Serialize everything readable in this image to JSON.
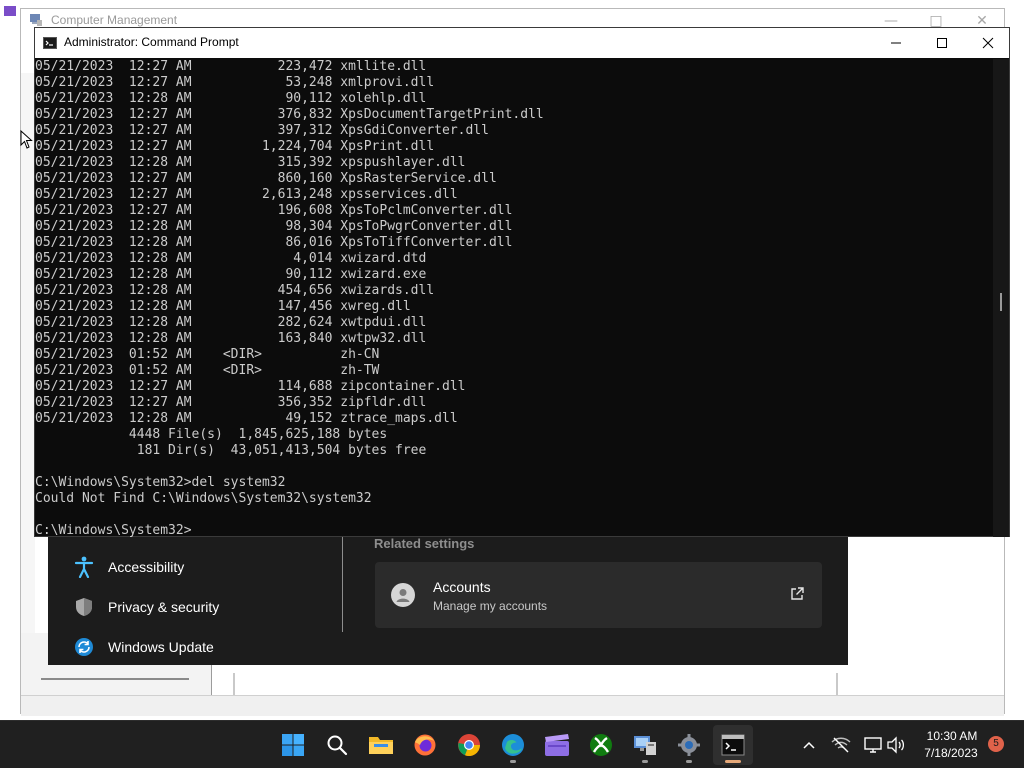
{
  "background_window": {
    "title": "Computer Management"
  },
  "settings": {
    "nav_items": [
      {
        "label": "Accessibility",
        "icon": "accessibility-icon"
      },
      {
        "label": "Privacy & security",
        "icon": "shield-icon"
      },
      {
        "label": "Windows Update",
        "icon": "windows-update-icon"
      }
    ],
    "related_settings_title": "Related settings",
    "accounts_card": {
      "title": "Accounts",
      "subtitle": "Manage my accounts",
      "icon": "external-link-icon"
    }
  },
  "cmd": {
    "title": "Administrator: Command Prompt",
    "lines": [
      "05/21/2023  12:27 AM           223,472 xmllite.dll",
      "05/21/2023  12:27 AM            53,248 xmlprovi.dll",
      "05/21/2023  12:28 AM            90,112 xolehlp.dll",
      "05/21/2023  12:27 AM           376,832 XpsDocumentTargetPrint.dll",
      "05/21/2023  12:27 AM           397,312 XpsGdiConverter.dll",
      "05/21/2023  12:27 AM         1,224,704 XpsPrint.dll",
      "05/21/2023  12:28 AM           315,392 xpspushlayer.dll",
      "05/21/2023  12:27 AM           860,160 XpsRasterService.dll",
      "05/21/2023  12:27 AM         2,613,248 xpsservices.dll",
      "05/21/2023  12:27 AM           196,608 XpsToPclmConverter.dll",
      "05/21/2023  12:28 AM            98,304 XpsToPwgrConverter.dll",
      "05/21/2023  12:28 AM            86,016 XpsToTiffConverter.dll",
      "05/21/2023  12:28 AM             4,014 xwizard.dtd",
      "05/21/2023  12:28 AM            90,112 xwizard.exe",
      "05/21/2023  12:28 AM           454,656 xwizards.dll",
      "05/21/2023  12:28 AM           147,456 xwreg.dll",
      "05/21/2023  12:28 AM           282,624 xwtpdui.dll",
      "05/21/2023  12:28 AM           163,840 xwtpw32.dll",
      "05/21/2023  01:52 AM    <DIR>          zh-CN",
      "05/21/2023  01:52 AM    <DIR>          zh-TW",
      "05/21/2023  12:27 AM           114,688 zipcontainer.dll",
      "05/21/2023  12:27 AM           356,352 zipfldr.dll",
      "05/21/2023  12:28 AM            49,152 ztrace_maps.dll",
      "            4448 File(s)  1,845,625,188 bytes",
      "             181 Dir(s)  43,051,413,504 bytes free",
      "",
      "C:\\Windows\\System32>del system32",
      "Could Not Find C:\\Windows\\System32\\system32",
      "",
      "C:\\Windows\\System32>"
    ]
  },
  "taskbar": {
    "apps": [
      {
        "name": "start-button",
        "icon": "windows-logo-icon",
        "running": false
      },
      {
        "name": "search-button",
        "icon": "search-icon",
        "running": false
      },
      {
        "name": "file-explorer-button",
        "icon": "folder-icon",
        "running": false
      },
      {
        "name": "firefox-button",
        "icon": "firefox-icon",
        "running": false
      },
      {
        "name": "chrome-button",
        "icon": "chrome-icon",
        "running": false
      },
      {
        "name": "edge-button",
        "icon": "edge-icon",
        "running": true
      },
      {
        "name": "media-app-button",
        "icon": "clapperboard-icon",
        "running": false
      },
      {
        "name": "xbox-button",
        "icon": "xbox-icon",
        "running": false
      },
      {
        "name": "computer-management-button",
        "icon": "computer-management-icon",
        "running": true
      },
      {
        "name": "settings-button",
        "icon": "gear-icon",
        "running": true
      },
      {
        "name": "terminal-button",
        "icon": "terminal-icon",
        "running": true,
        "active": true
      }
    ],
    "tray": {
      "icons": [
        "chevron-up-icon",
        "network-off-icon",
        "display-icon",
        "volume-icon"
      ],
      "time": "10:30 AM",
      "date": "7/18/2023",
      "notification_count": "5"
    }
  }
}
